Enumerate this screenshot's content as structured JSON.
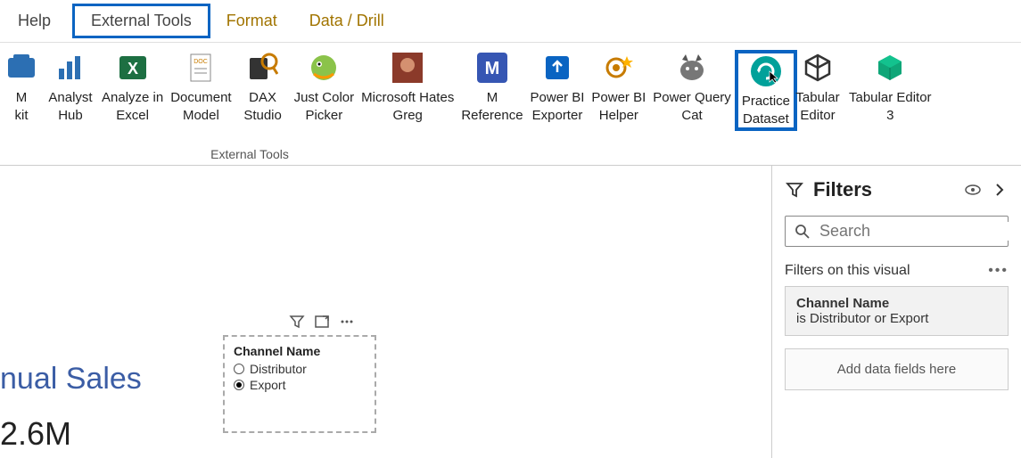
{
  "tabs": {
    "help": "Help",
    "external_tools": "External Tools",
    "format": "Format",
    "data_drill": "Data / Drill"
  },
  "ribbon": {
    "group_label": "External Tools",
    "items": [
      {
        "label1": "M",
        "label2": "kit"
      },
      {
        "label1": "Analyst",
        "label2": "Hub"
      },
      {
        "label1": "Analyze in",
        "label2": "Excel"
      },
      {
        "label1": "Document",
        "label2": "Model"
      },
      {
        "label1": "DAX",
        "label2": "Studio"
      },
      {
        "label1": "Just Color",
        "label2": "Picker"
      },
      {
        "label1": "Microsoft Hates",
        "label2": "Greg"
      },
      {
        "label1": "M",
        "label2": "Reference"
      },
      {
        "label1": "Power BI",
        "label2": "Exporter"
      },
      {
        "label1": "Power BI",
        "label2": "Helper"
      },
      {
        "label1": "Power Query",
        "label2": "Cat"
      },
      {
        "label1": "Practice",
        "label2": "Dataset"
      },
      {
        "label1": "Tabular",
        "label2": "Editor"
      },
      {
        "label1": "Tabular Editor",
        "label2": "3"
      }
    ]
  },
  "canvas": {
    "title": "nual Sales",
    "value": "2.6M",
    "slicer": {
      "title": "Channel Name",
      "options": [
        {
          "label": "Distributor",
          "checked": false
        },
        {
          "label": "Export",
          "checked": true
        }
      ]
    }
  },
  "filters": {
    "title": "Filters",
    "search_placeholder": "Search",
    "section": "Filters on this visual",
    "card": {
      "name": "Channel Name",
      "condition": "is Distributor or Export"
    },
    "add_hint": "Add data fields here"
  }
}
